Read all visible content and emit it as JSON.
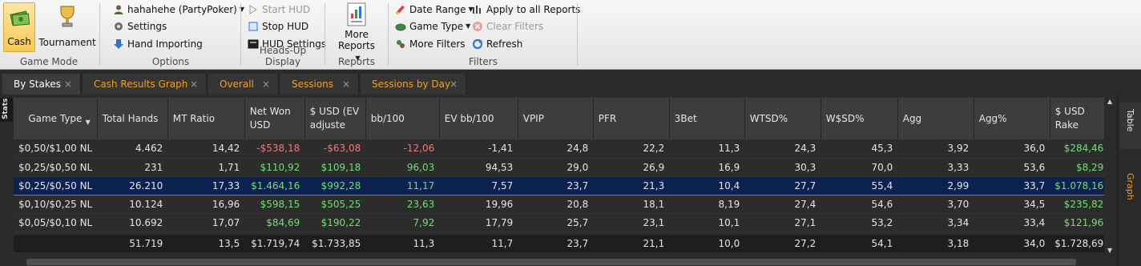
{
  "ribbon": {
    "game_mode": {
      "title": "Game Mode",
      "cash_label": "Cash",
      "tournament_label": "Tournament"
    },
    "options": {
      "title": "Options",
      "player_label": "hahahehe (PartyPoker)",
      "settings_label": "Settings",
      "hand_importing_label": "Hand Importing"
    },
    "hud": {
      "title": "Heads-Up Display",
      "start_label": "Start HUD",
      "stop_label": "Stop HUD",
      "settings_label": "HUD Settings"
    },
    "reports": {
      "title": "Reports",
      "more_line1": "More",
      "more_line2": "Reports"
    },
    "filters": {
      "title": "Filters",
      "date_range_label": "Date Range",
      "game_type_label": "Game Type",
      "more_filters_label": "More Filters",
      "apply_all_label": "Apply to all Reports",
      "clear_filters_label": "Clear Filters",
      "refresh_label": "Refresh"
    }
  },
  "tabs": [
    {
      "label": "By Stakes",
      "active": true
    },
    {
      "label": "Cash Results Graph",
      "active": false
    },
    {
      "label": "Overall",
      "active": false
    },
    {
      "label": "Sessions",
      "active": false
    },
    {
      "label": "Sessions by Day",
      "active": false
    }
  ],
  "stats_tab_label": "Stats",
  "side_tabs": {
    "table_label": "Table",
    "graph_label": "Graph"
  },
  "grid": {
    "headers": [
      "Game Type",
      "Total Hands",
      "MT Ratio",
      "Net Won USD",
      "$ USD (EV adjuste",
      "bb/100",
      "EV bb/100",
      "VPIP",
      "PFR",
      "3Bet",
      "WTSD%",
      "W$SD%",
      "Agg",
      "Agg%",
      "$ USD Rake"
    ],
    "rows": [
      [
        "$0,50/$1,00 NL",
        "4.462",
        "14,42",
        "-$538,18",
        "-$63,08",
        "-12,06",
        "-1,41",
        "24,8",
        "22,2",
        "11,3",
        "24,3",
        "45,3",
        "3,92",
        "36,0",
        "$284,46"
      ],
      [
        "$0,25/$0,50 NL",
        "231",
        "1,71",
        "$110,92",
        "$109,18",
        "96,03",
        "94,53",
        "29,0",
        "26,9",
        "16,9",
        "30,3",
        "70,0",
        "3,33",
        "53,6",
        "$8,29"
      ],
      [
        "$0,25/$0,50 NL",
        "26.210",
        "17,33",
        "$1.464,16",
        "$992,28",
        "11,17",
        "7,57",
        "23,7",
        "21,3",
        "10,4",
        "27,7",
        "55,4",
        "2,99",
        "33,7",
        "$1.078,16"
      ],
      [
        "$0,10/$0,25 NL",
        "10.124",
        "16,96",
        "$598,15",
        "$505,25",
        "23,63",
        "19,96",
        "20,8",
        "18,1",
        "8,19",
        "27,4",
        "54,6",
        "3,70",
        "34,5",
        "$235,82"
      ],
      [
        "$0,05/$0,10 NL",
        "10.692",
        "17,07",
        "$84,69",
        "$190,22",
        "7,92",
        "17,79",
        "25,7",
        "23,1",
        "10,1",
        "27,1",
        "53,2",
        "3,34",
        "33,4",
        "$121,96"
      ]
    ],
    "selected_row": 2,
    "totals": [
      "",
      "51.719",
      "13,5",
      "$1.719,74",
      "$1.733,85",
      "11,3",
      "11,7",
      "23,7",
      "21,1",
      "10,0",
      "27,2",
      "54,1",
      "3,18",
      "34,0",
      "$1.728,69"
    ]
  },
  "colors": {
    "positive": "#6fe06f",
    "negative": "#ef7878",
    "tab_text": "#f0a020",
    "selected_row": "#0b2150"
  }
}
